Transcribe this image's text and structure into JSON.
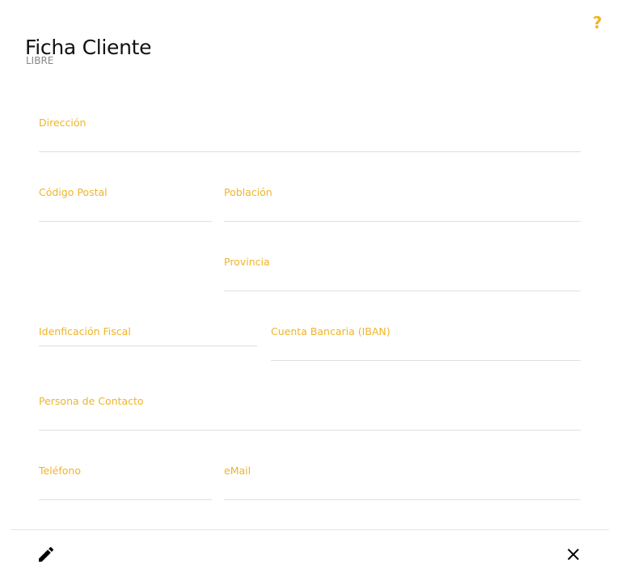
{
  "header": {
    "title": "Ficha Cliente",
    "subtitle": "LIBRE",
    "help_label": "?"
  },
  "form": {
    "direccion": {
      "label": "Dirección",
      "value": "",
      "placeholder": ""
    },
    "codigo_postal": {
      "label": "Código Postal",
      "value": "",
      "placeholder": ""
    },
    "poblacion": {
      "label": "Población",
      "value": "",
      "placeholder": ""
    },
    "provincia": {
      "label": "Provincia",
      "value": "",
      "placeholder": ""
    },
    "identificacion_fiscal": {
      "label": "Idenficación Fiscal",
      "value": "",
      "placeholder": ""
    },
    "cuenta_bancaria": {
      "label": "Cuenta Bancaria (IBAN)",
      "value": "",
      "placeholder": ""
    },
    "persona_contacto": {
      "label": "Persona de Contacto",
      "value": "",
      "placeholder": ""
    },
    "telefono": {
      "label": "Teléfono",
      "value": "",
      "placeholder": ""
    },
    "email": {
      "label": "eMail",
      "value": "",
      "placeholder": ""
    }
  },
  "footer": {
    "edit_icon": "pencil-icon",
    "close_icon": "close-icon"
  },
  "colors": {
    "accent": "#f0b428",
    "title": "#111111",
    "subtitle": "#888888",
    "divider": "#e0e0e0"
  }
}
